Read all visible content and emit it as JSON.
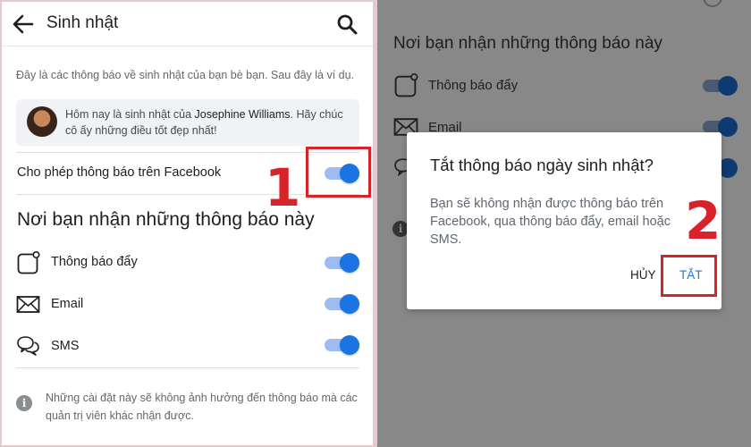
{
  "left": {
    "header": {
      "title": "Sinh nhật"
    },
    "description": "Đây là các thông báo về sinh nhật của bạn bè bạn. Sau đây là ví dụ.",
    "preview": {
      "prefix": "Hôm nay là sinh nhật của ",
      "name": "Josephine Williams",
      "suffix": ". Hãy chúc cô ấy những điều tốt đẹp nhất!"
    },
    "allow_label": "Cho phép thông báo trên Facebook",
    "allow_enabled": true,
    "section_title": "Nơi bạn nhận những thông báo này",
    "channels": [
      {
        "label": "Thông báo đẩy",
        "icon": "push-notification-icon",
        "enabled": true
      },
      {
        "label": "Email",
        "icon": "email-icon",
        "enabled": true
      },
      {
        "label": "SMS",
        "icon": "sms-icon",
        "enabled": true
      }
    ],
    "note": "Những cài đặt này sẽ không ảnh hưởng đến thông báo mà các quản trị viên khác nhận được.",
    "step_number": "1"
  },
  "right": {
    "section_title": "Nơi bạn nhận những thông báo này",
    "channels": [
      {
        "label": "Thông báo đẩy"
      },
      {
        "label": "Email"
      }
    ],
    "dialog": {
      "title": "Tắt thông báo ngày sinh nhật?",
      "body": "Bạn sẽ không nhận được thông báo trên Facebook, qua thông báo đẩy, email hoặc SMS.",
      "cancel_label": "HỦY",
      "confirm_label": "TẮT"
    },
    "step_number": "2"
  },
  "colors": {
    "accent": "#1b74e4",
    "highlight": "#d9232b",
    "divider": "#e6c9cd"
  }
}
